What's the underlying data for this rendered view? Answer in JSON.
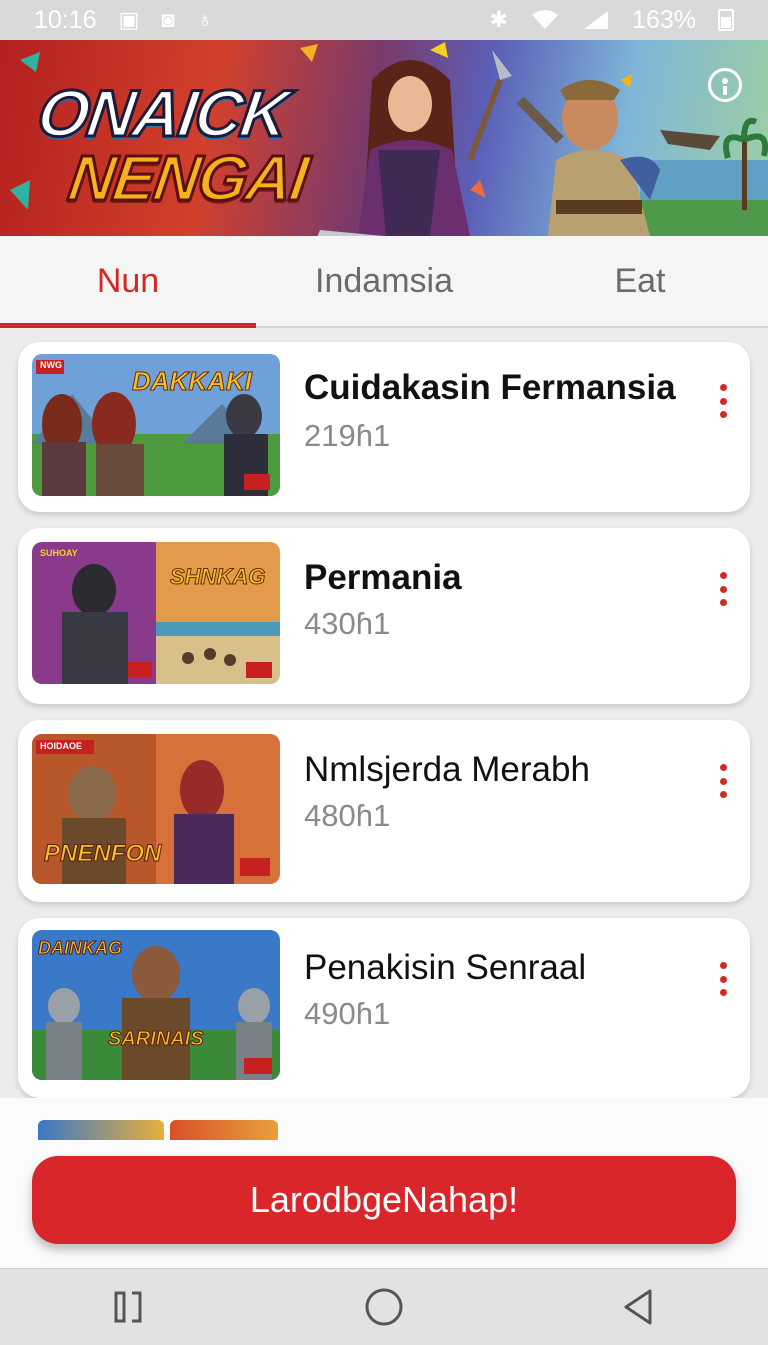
{
  "status_bar": {
    "time": "10:16",
    "battery": "163%"
  },
  "banner": {
    "logo_line1": "ONAICK",
    "logo_line2": "NENGAI"
  },
  "tabs": [
    {
      "label": "Nun",
      "active": true
    },
    {
      "label": "Indamsia",
      "active": false
    },
    {
      "label": "Eat",
      "active": false
    }
  ],
  "games": [
    {
      "title": "Cuidakasin Fermansia",
      "count": "219ɦ1",
      "thumb_badge": "NWG",
      "thumb_title": "DAKKAKI"
    },
    {
      "title": "Permania",
      "count": "430ɦ1",
      "thumb_badge": "SUHOAY",
      "thumb_title": "SHNKAG"
    },
    {
      "title": "Nmlsjerda Merabh",
      "count": "480ɦ1",
      "thumb_badge": "HOIDAOE",
      "thumb_title": "PNENFON"
    },
    {
      "title": "Penakisin Senraal",
      "count": "490ɦ1",
      "thumb_badge": "DAINKAG",
      "thumb_title": "SARINAIS"
    }
  ],
  "cta": {
    "label": "LarodbgeNahap!"
  },
  "colors": {
    "accent": "#d12a24",
    "background": "#ececec"
  }
}
